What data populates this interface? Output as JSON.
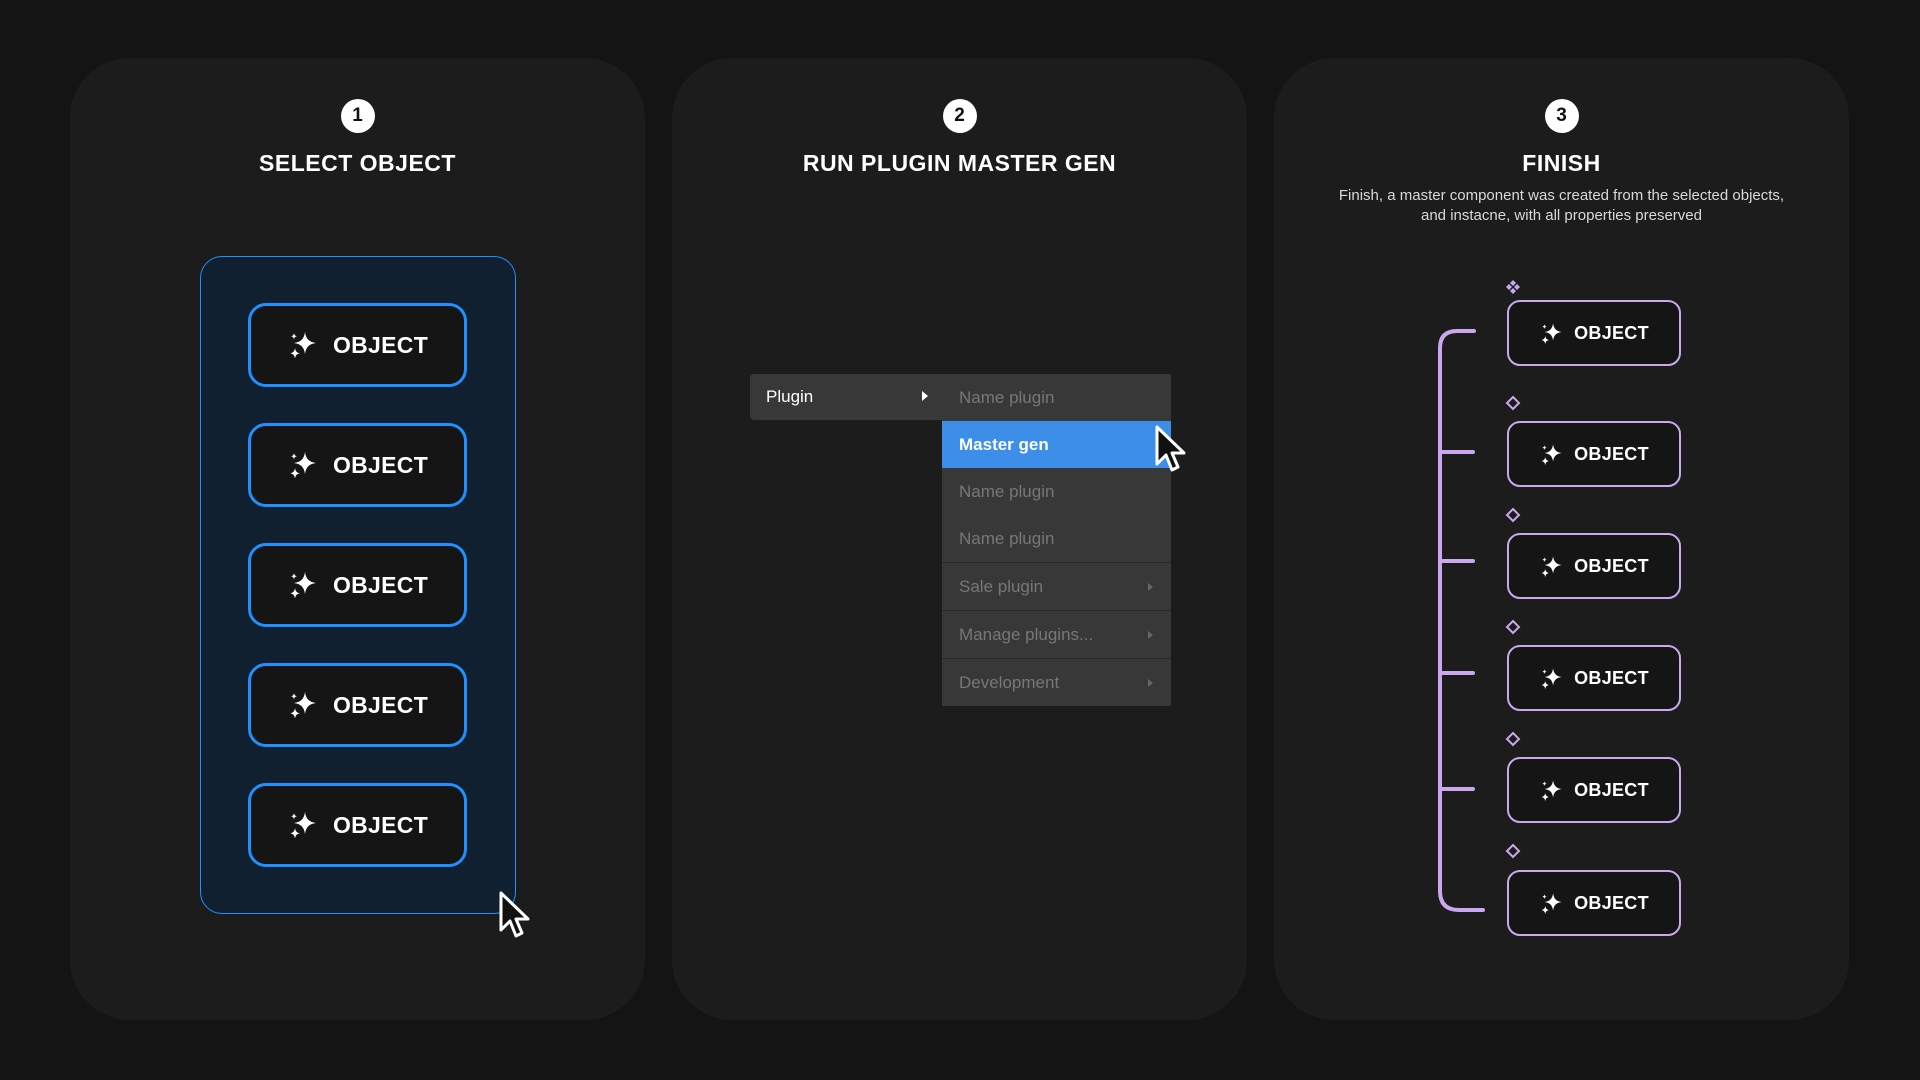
{
  "steps": [
    {
      "number": "1",
      "title": "SELECT OBJECT"
    },
    {
      "number": "2",
      "title": "RUN PLUGIN MASTER GEN"
    },
    {
      "number": "3",
      "title": "FINISH",
      "description": "Finish, a master component was created from the selected objects, and instacne, with all properties preserved"
    }
  ],
  "object_label": "OBJECT",
  "menu": {
    "main_item": "Plugin",
    "submenu": [
      {
        "label": "Name plugin",
        "state": "disabled"
      },
      {
        "label": "Master gen",
        "state": "active"
      },
      {
        "label": "Name plugin",
        "state": "disabled"
      },
      {
        "label": "Name plugin",
        "state": "disabled"
      },
      {
        "label": "Sale plugin",
        "state": "disabled",
        "has_submenu": true
      },
      {
        "label": "Manage plugins...",
        "state": "disabled",
        "has_submenu": true
      },
      {
        "label": "Development",
        "state": "disabled",
        "has_submenu": true
      }
    ]
  },
  "icons": {
    "object": "sparkle-icon",
    "cursor": "pointer-cursor-icon",
    "master": "component-master-icon",
    "instance": "component-instance-icon"
  },
  "colors": {
    "background": "#141414",
    "panel": "#1c1c1c",
    "selection_blue": "#1e90ff",
    "menu_active": "#3d8ee8",
    "component_purple": "#c9a8ee"
  }
}
